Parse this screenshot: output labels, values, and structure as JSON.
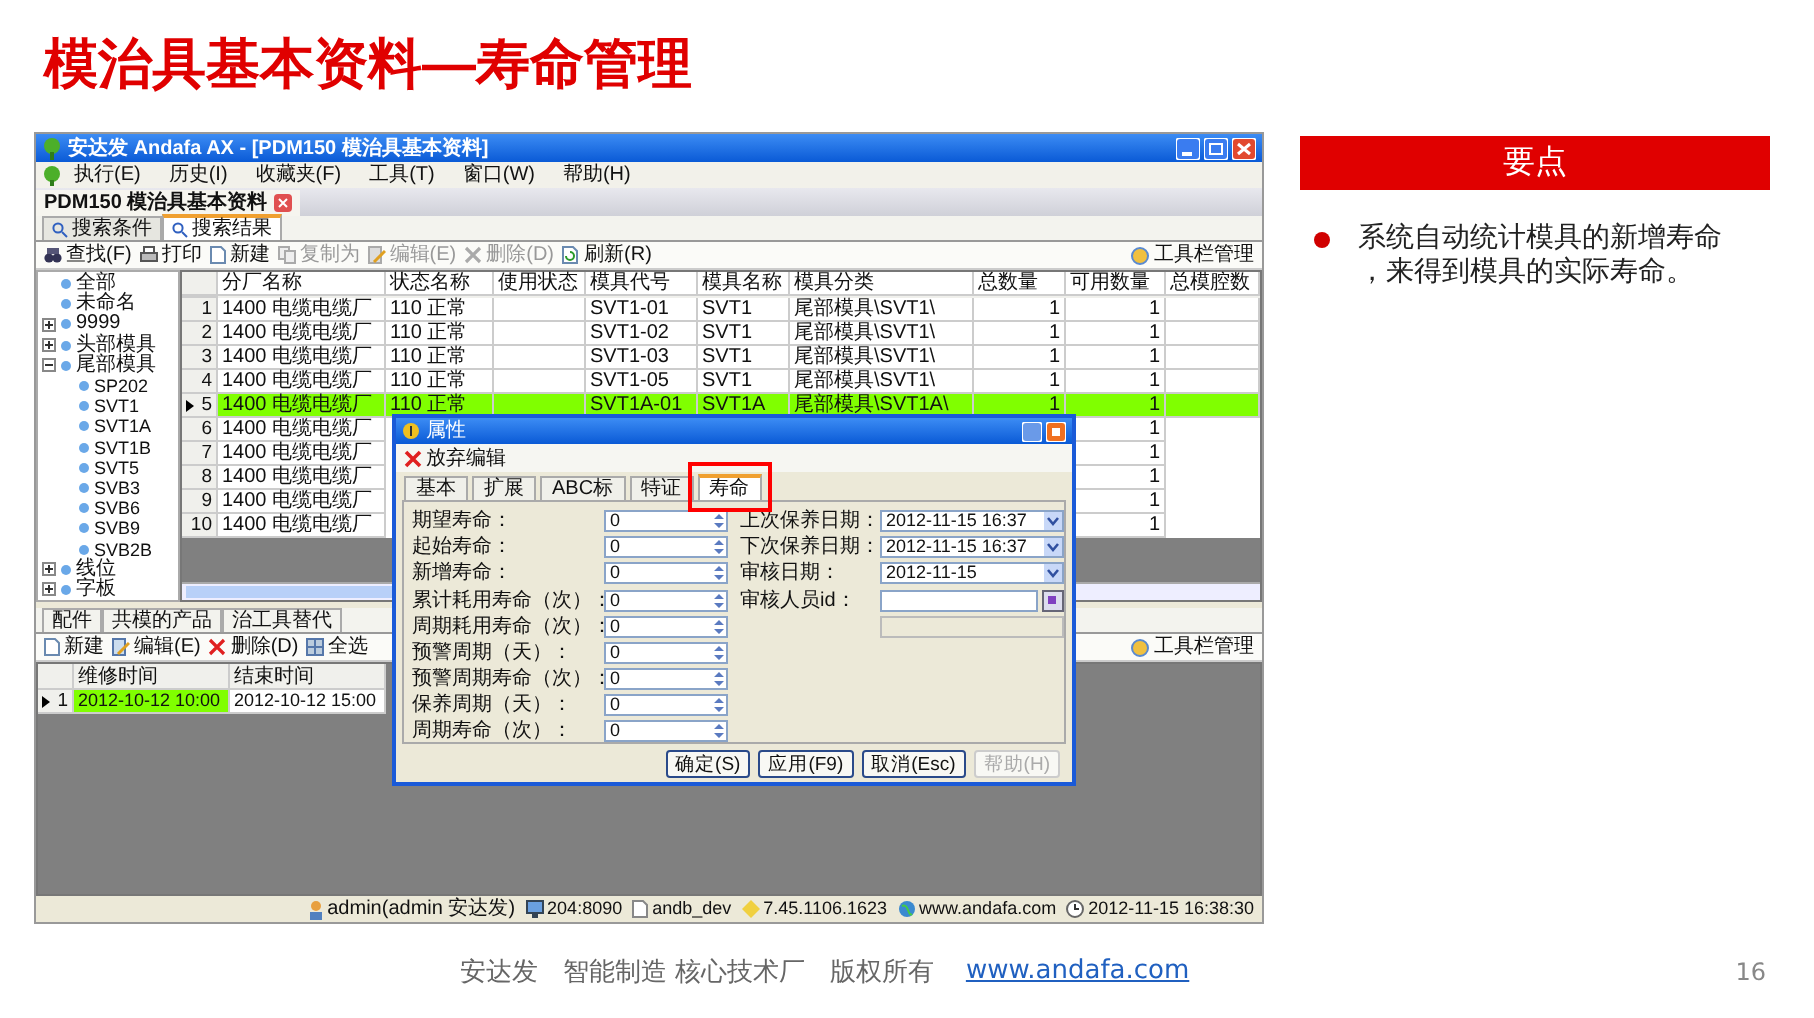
{
  "slide": {
    "title": "模治具基本资料—寿命管理",
    "page": "16"
  },
  "app": {
    "title": "安达发 Andafa AX - [PDM150 模治具基本资料]",
    "menu": [
      "执行(E)",
      "历史(I)",
      "收藏夹(F)",
      "工具(T)",
      "窗口(W)",
      "帮助(H)"
    ],
    "document_tab": "PDM150 模治具基本资料",
    "tabs": [
      {
        "label": "搜索条件",
        "selected": false
      },
      {
        "label": "搜索结果",
        "selected": true
      }
    ],
    "toolbar": [
      {
        "label": "查找(F)",
        "disabled": false
      },
      {
        "label": "打印",
        "disabled": false
      },
      {
        "label": "新建",
        "disabled": false
      },
      {
        "label": "复制为",
        "disabled": true
      },
      {
        "label": "编辑(E)",
        "disabled": true
      },
      {
        "label": "删除(D)",
        "disabled": true
      },
      {
        "label": "刷新(R)",
        "disabled": false
      }
    ],
    "toolbar_manage": "工具栏管理",
    "tree": [
      {
        "label": "全部"
      },
      {
        "label": "未命名"
      },
      {
        "label": "9999",
        "expanded": false
      },
      {
        "label": "头部模具",
        "expanded": false
      },
      {
        "label": "尾部模具",
        "expanded": true,
        "children": [
          {
            "label": "SP202"
          },
          {
            "label": "SVT1"
          },
          {
            "label": "SVT1A"
          },
          {
            "label": "SVT1B"
          },
          {
            "label": "SVT5"
          },
          {
            "label": "SVB3"
          },
          {
            "label": "SVB6"
          },
          {
            "label": "SVB9"
          },
          {
            "label": "SVB2B"
          }
        ]
      },
      {
        "label": "线位",
        "expanded": false
      },
      {
        "label": "字板",
        "expanded": false
      }
    ],
    "grid": {
      "columns": [
        "分厂名称",
        "状态名称",
        "使用状态",
        "模具代号",
        "模具名称",
        "模具分类",
        "总数量",
        "可用数量",
        "总模腔数"
      ],
      "rows": [
        {
          "num": "1",
          "selected": false,
          "cells": [
            "1400 电缆电缆厂",
            "110 正常",
            null,
            "SVT1-01",
            "SVT1",
            "尾部模具\\SVT1\\",
            "1",
            "1",
            null
          ]
        },
        {
          "num": "2",
          "selected": false,
          "cells": [
            "1400 电缆电缆厂",
            "110 正常",
            null,
            "SVT1-02",
            "SVT1",
            "尾部模具\\SVT1\\",
            "1",
            "1",
            null
          ]
        },
        {
          "num": "3",
          "selected": false,
          "cells": [
            "1400 电缆电缆厂",
            "110 正常",
            null,
            "SVT1-03",
            "SVT1",
            "尾部模具\\SVT1\\",
            "1",
            "1",
            null
          ]
        },
        {
          "num": "4",
          "selected": false,
          "cells": [
            "1400 电缆电缆厂",
            "110 正常",
            null,
            "SVT1-05",
            "SVT1",
            "尾部模具\\SVT1\\",
            "1",
            "1",
            null
          ]
        },
        {
          "num": "5",
          "selected": true,
          "cells": [
            "1400 电缆电缆厂",
            "110 正常",
            null,
            "SVT1A-01",
            "SVT1A",
            "尾部模具\\SVT1A\\",
            "1",
            "1",
            null
          ]
        },
        {
          "num": "6",
          "selected": false,
          "cells": [
            "1400 电缆电缆厂",
            null,
            null,
            null,
            null,
            null,
            null,
            "1",
            null
          ]
        },
        {
          "num": "7",
          "selected": false,
          "cells": [
            "1400 电缆电缆厂",
            null,
            null,
            null,
            null,
            null,
            null,
            "1",
            null
          ]
        },
        {
          "num": "8",
          "selected": false,
          "cells": [
            "1400 电缆电缆厂",
            null,
            null,
            null,
            null,
            null,
            null,
            "1",
            null
          ]
        },
        {
          "num": "9",
          "selected": false,
          "cells": [
            "1400 电缆电缆厂",
            null,
            null,
            null,
            null,
            null,
            null,
            "1",
            null
          ]
        },
        {
          "num": "10",
          "selected": false,
          "cells": [
            "1400 电缆电缆厂",
            null,
            null,
            null,
            null,
            null,
            null,
            "1",
            null
          ]
        }
      ]
    },
    "detail_tabs": [
      {
        "label": "配件",
        "selected": false
      },
      {
        "label": "共模的产品",
        "selected": false
      },
      {
        "label": "治工具替代",
        "selected": false
      }
    ],
    "detail_toolbar": [
      "新建",
      "编辑(E)",
      "删除(D)",
      "全选"
    ],
    "detail_toolbar_manage": "工具栏管理",
    "detail_grid": {
      "columns": [
        "维修时间",
        "结束时间"
      ],
      "rows": [
        {
          "num": "1",
          "selected": true,
          "cells": [
            "2012-10-12 10:00",
            "2012-10-12 15:00"
          ]
        }
      ]
    },
    "status_bar": [
      "admin(admin 安达发)",
      "204:8090",
      "andb_dev",
      "7.45.1106.1623",
      "www.andafa.com",
      "2012-11-15 16:38:30"
    ]
  },
  "dialog": {
    "title": "属性",
    "discard": "放弃编辑",
    "tabs": [
      {
        "label": "基本",
        "selected": false,
        "highlighted": false
      },
      {
        "label": "扩展",
        "selected": false,
        "highlighted": false
      },
      {
        "label": "ABC标",
        "selected": false,
        "highlighted": false
      },
      {
        "label": "特证",
        "selected": false,
        "highlighted": false
      },
      {
        "label": "寿命",
        "selected": true,
        "highlighted": true
      }
    ],
    "left_fields": [
      {
        "label": "期望寿命：",
        "value": "0"
      },
      {
        "label": "起始寿命：",
        "value": "0"
      },
      {
        "label": "新增寿命：",
        "value": "0"
      },
      {
        "label": "累计耗用寿命（次）：",
        "value": "0"
      },
      {
        "label": "周期耗用寿命（次）：",
        "value": "0"
      },
      {
        "label": "预警周期（天）：",
        "value": "0"
      },
      {
        "label": "预警周期寿命（次）：",
        "value": "0"
      },
      {
        "label": "保养周期（天）：",
        "value": "0"
      },
      {
        "label": "周期寿命（次）：",
        "value": "0"
      }
    ],
    "right_fields": [
      {
        "kind": "combo",
        "label": "上次保养日期：",
        "value": "2012-11-15 16:37"
      },
      {
        "kind": "combo",
        "label": "下次保养日期：",
        "value": "2012-11-15 16:37"
      },
      {
        "kind": "combo",
        "label": "审核日期：",
        "value": "2012-11-15"
      },
      {
        "kind": "lookup",
        "label": "审核人员id："
      },
      {
        "kind": "readonly"
      }
    ],
    "buttons": [
      {
        "label": "确定(S)",
        "disabled": false
      },
      {
        "label": "应用(F9)",
        "disabled": false
      },
      {
        "label": "取消(Esc)",
        "disabled": false
      },
      {
        "label": "帮助(H)",
        "disabled": true
      }
    ]
  },
  "key_points": {
    "title": "要点",
    "items": [
      "系统自动统计模具的新增寿命，来得到模具的实际寿命。"
    ]
  },
  "footer": {
    "text": "安达发   智能制造 核心技术厂   版权所有",
    "link": "www.andafa.com"
  }
}
